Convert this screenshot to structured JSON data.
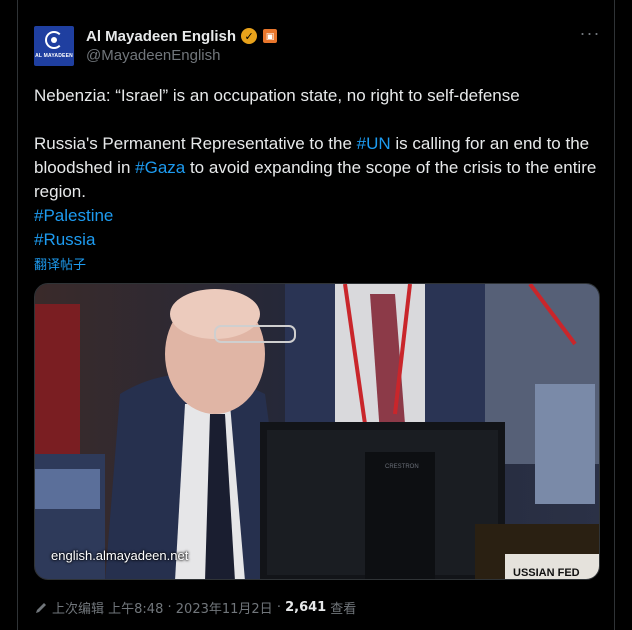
{
  "account": {
    "display_name": "Al Mayadeen English",
    "handle": "@MayadeenEnglish",
    "avatar_text": "AL MAYADEEN",
    "verified_icon": "verified-badge-icon",
    "affiliate_icon": "affiliate-badge-icon"
  },
  "tweet": {
    "headline": "Nebenzia: “Israel” is an occupation state, no right to self-defense",
    "body_part1": "Russia's Permanent Representative to the ",
    "tag_un": "#UN",
    "body_part2": " is calling for an end to the bloodshed in ",
    "tag_gaza": "#Gaza",
    "body_part3": " to avoid expanding the scope of the crisis to the entire region.",
    "tag_palestine": "#Palestine",
    "tag_russia": "#Russia",
    "translate_label": "翻译帖子"
  },
  "media": {
    "caption": "english.almayadeen.net",
    "monitor_brand": "CRESTRON",
    "nameplate_text": "USSIAN FED"
  },
  "meta": {
    "edited_label": "上次编辑",
    "time": "上午8:48",
    "separator": "·",
    "date": "2023年11月2日",
    "views_count": "2,641",
    "views_label": "查看"
  },
  "colors": {
    "background": "#000000",
    "text": "#e7e9ea",
    "muted": "#71767b",
    "link": "#1d9bf0",
    "verified": "#e8a21b"
  }
}
